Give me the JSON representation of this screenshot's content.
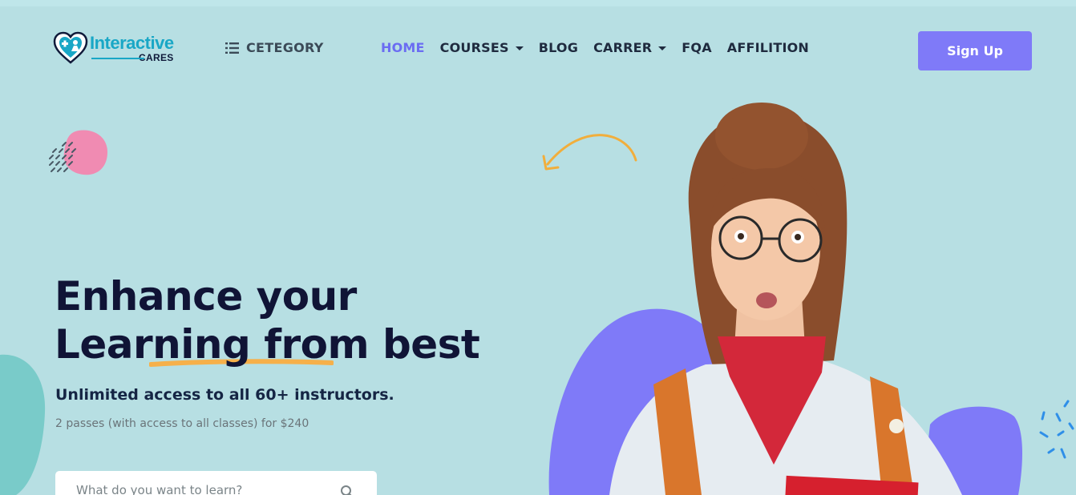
{
  "header": {
    "logo": {
      "main": "Interactive",
      "sub": "CARES"
    },
    "category_label": "CETEGORY",
    "nav": [
      {
        "label": "HOME",
        "active": true,
        "dropdown": false
      },
      {
        "label": "COURSES",
        "active": false,
        "dropdown": true
      },
      {
        "label": "BLOG",
        "active": false,
        "dropdown": false
      },
      {
        "label": "CARRER",
        "active": false,
        "dropdown": true
      },
      {
        "label": "FQA",
        "active": false,
        "dropdown": false
      },
      {
        "label": "AFFILITION",
        "active": false,
        "dropdown": false
      }
    ],
    "signup_label": "Sign Up"
  },
  "hero": {
    "title_line1": "Enhance your",
    "title_line2": "Learning from best",
    "subtitle": "Unlimited access to all 60+ instructors.",
    "note": "2 passes (with access to all classes) for $240",
    "search": {
      "placeholder": "What do you want to learn?"
    }
  },
  "icons": {
    "category": "list-icon",
    "search": "search-icon",
    "arrow": "curved-arrow-icon"
  },
  "colors": {
    "background": "#b7dfe3",
    "accent": "#7f7af8",
    "active_nav": "#6b6df2",
    "heading": "#101436",
    "underline": "#f6b04a",
    "blob_pink": "#f08bb2",
    "blob_teal": "#79cbc9"
  }
}
